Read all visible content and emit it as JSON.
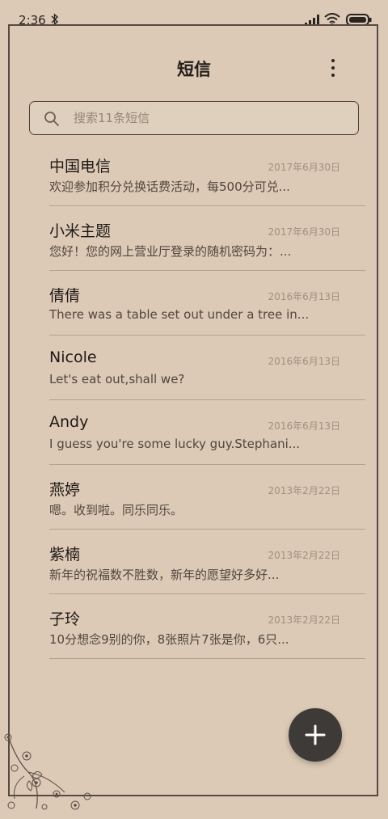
{
  "status_bar": {
    "time": "2:36",
    "icons": [
      "bluetooth-icon",
      "signal-icon",
      "wifi-icon",
      "battery-icon"
    ]
  },
  "header": {
    "title": "短信",
    "more_icon": "more-vertical-icon"
  },
  "search": {
    "placeholder": "搜索11条短信",
    "icon": "search-icon"
  },
  "messages": [
    {
      "sender": "中国电信",
      "date": "2017年6月30日",
      "preview": "欢迎参加积分兑换话费活动，每500分可兑..."
    },
    {
      "sender": "小米主题",
      "date": "2017年6月30日",
      "preview": "您好！您的网上营业厅登录的随机密码为：..."
    },
    {
      "sender": "倩倩",
      "date": "2016年6月13日",
      "preview": "There was a table set out under a tree in..."
    },
    {
      "sender": "Nicole",
      "date": "2016年6月13日",
      "preview": "Let's eat out,shall we?"
    },
    {
      "sender": "Andy",
      "date": "2016年6月13日",
      "preview": "I guess you're some lucky guy.Stephani..."
    },
    {
      "sender": "燕婷",
      "date": "2013年2月22日",
      "preview": "嗯。收到啦。同乐同乐。"
    },
    {
      "sender": "紫楠",
      "date": "2013年2月22日",
      "preview": "新年的祝福数不胜数，新年的愿望好多好..."
    },
    {
      "sender": "子玲",
      "date": "2013年2月22日",
      "preview": "10分想念9别的你，8张照片7张是你，6只..."
    }
  ],
  "compose": {
    "icon": "plus-icon"
  },
  "colors": {
    "background": "#dccab6",
    "frame": "#574a42",
    "fab": "#3d3a38",
    "date_text": "#a09080"
  }
}
